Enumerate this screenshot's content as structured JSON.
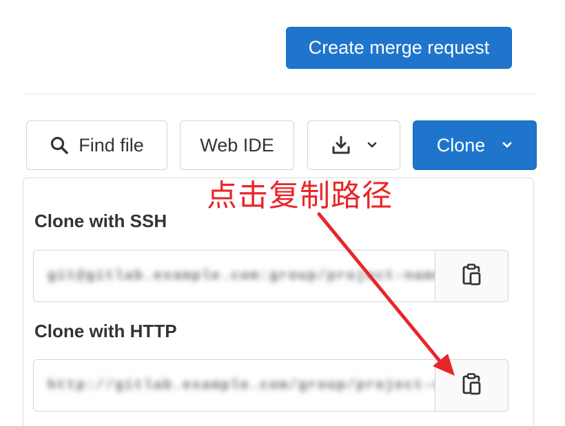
{
  "header": {
    "create_mr_label": "Create merge request"
  },
  "toolbar": {
    "find_file_label": "Find file",
    "web_ide_label": "Web IDE",
    "clone_label": "Clone"
  },
  "clone_dropdown": {
    "ssh_title": "Clone with SSH",
    "ssh_url": "git@gitlab.example.com:group/project-name.git",
    "http_title": "Clone with HTTP",
    "http_url": "http://gitlab.example.com/group/project-name.git"
  },
  "annotation": {
    "text": "点击复制路径",
    "color": "#e8262a"
  },
  "colors": {
    "primary": "#1f75cb",
    "border": "#d4d4d8"
  },
  "icons": {
    "find": "search-icon",
    "download": "download-icon",
    "chevron": "chevron-down-icon",
    "copy": "copy-to-clipboard-icon"
  }
}
